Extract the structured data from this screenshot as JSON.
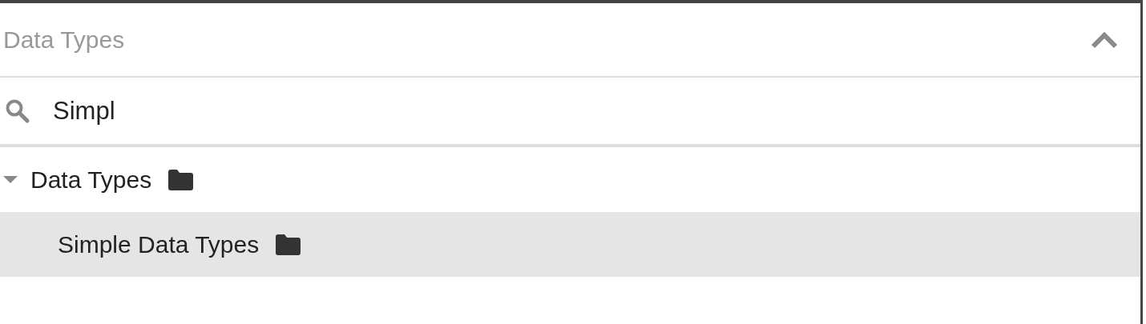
{
  "panel": {
    "title": "Data Types",
    "expanded": true
  },
  "search": {
    "value": "Simpl"
  },
  "tree": [
    {
      "label": "Data Types",
      "expanded": true,
      "selected": false,
      "children": [
        {
          "label": "Simple Data Types",
          "selected": true
        }
      ]
    }
  ]
}
